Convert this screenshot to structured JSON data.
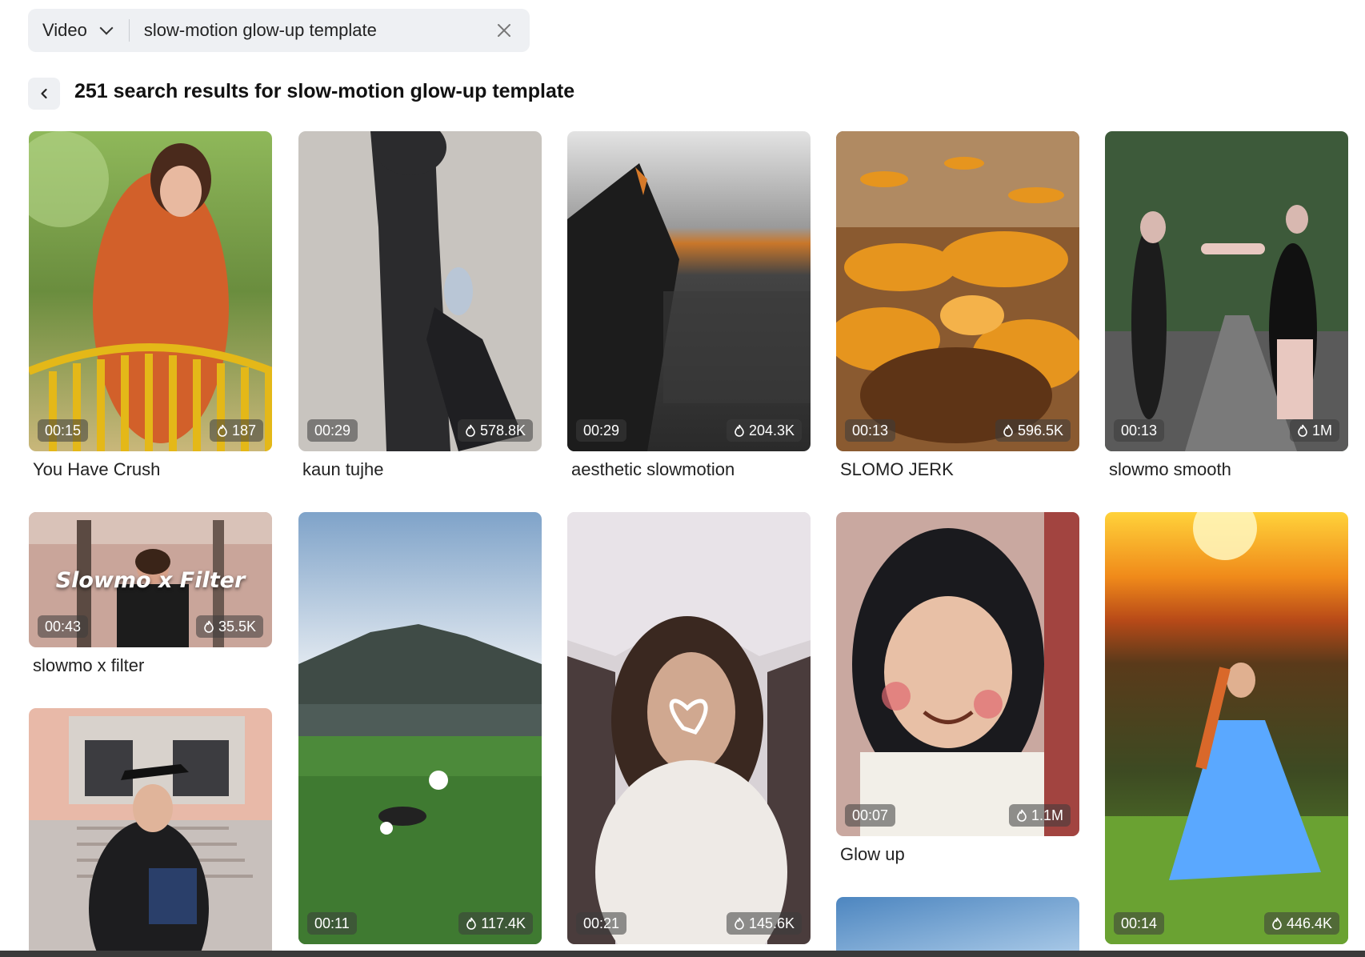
{
  "search": {
    "type_label": "Video",
    "query": "slow-motion glow-up template",
    "placeholder": "Search"
  },
  "results": {
    "title": "251 search results for slow-motion glow-up template"
  },
  "cards": [
    {
      "duration": "00:15",
      "views": "187",
      "title": "You Have Crush"
    },
    {
      "duration": "00:29",
      "views": "578.8K",
      "title": "kaun tujhe"
    },
    {
      "duration": "00:29",
      "views": "204.3K",
      "title": "aesthetic slowmotion"
    },
    {
      "duration": "00:13",
      "views": "596.5K",
      "title": "SLOMO JERK"
    },
    {
      "duration": "00:13",
      "views": "1M",
      "title": "slowmo smooth"
    },
    {
      "duration": "00:43",
      "views": "35.5K",
      "title": "slowmo x filter",
      "overlay": "Slowmo x Filter"
    },
    {
      "duration": "00:11",
      "views": "117.4K",
      "title": ""
    },
    {
      "duration": "00:21",
      "views": "145.6K",
      "title": ""
    },
    {
      "duration": "00:07",
      "views": "1.1M",
      "title": "Glow up"
    },
    {
      "duration": "00:14",
      "views": "446.4K",
      "title": ""
    },
    {
      "duration": "",
      "views": "",
      "title": ""
    },
    {
      "duration": "",
      "views": "",
      "title": ""
    }
  ],
  "colors": {
    "search_bg": "#eef0f3",
    "badge_bg": "rgba(60,60,60,0.55)"
  },
  "icons": [
    "chevron-down-icon",
    "close-icon",
    "back-arrow-icon",
    "fire-icon"
  ]
}
